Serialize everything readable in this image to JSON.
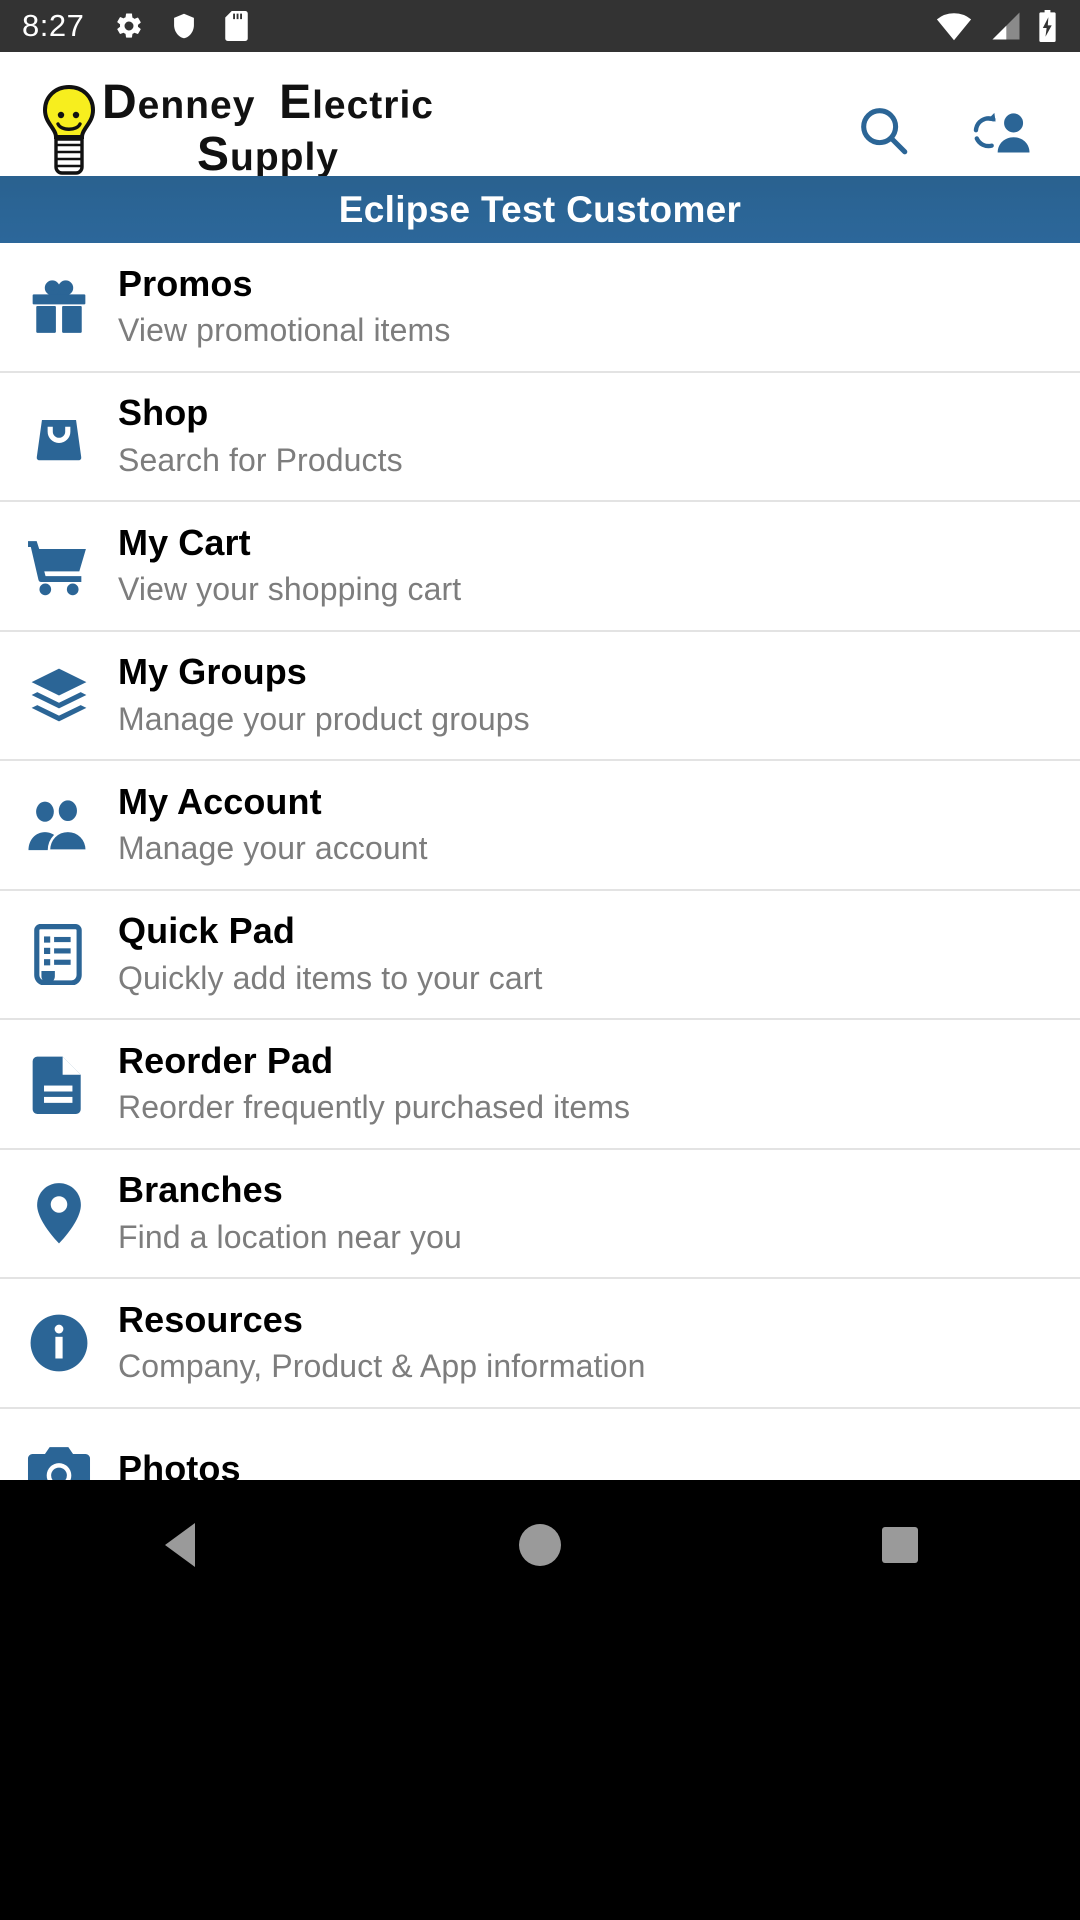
{
  "status_bar": {
    "time": "8:27",
    "left_icons": [
      "gear-icon",
      "shield-icon",
      "sd-card-icon"
    ],
    "right_icons": [
      "wifi-icon",
      "cell-signal-icon",
      "battery-charging-icon"
    ],
    "background": "#333333"
  },
  "header": {
    "logo": {
      "line1_part1": "D",
      "line1_rest": "enney",
      "line1_part2": "E",
      "line1_rest2": "lectric",
      "line2_part1": "S",
      "line2_rest": "upply",
      "full_text": "Denney Electric Supply",
      "bulb_color": "#f7ee1e"
    },
    "search_label": "search-icon",
    "switch_user_label": "switch-user-icon",
    "icon_color": "#2b6596"
  },
  "banner": {
    "customer_name": "Eclipse Test Customer",
    "background": "#2b6596",
    "text_color": "#ffffff"
  },
  "menu": {
    "items": [
      {
        "icon": "gift-icon",
        "title": "Promos",
        "subtitle": "View promotional items"
      },
      {
        "icon": "shopping-bag-icon",
        "title": "Shop",
        "subtitle": "Search for Products"
      },
      {
        "icon": "shopping-cart-icon",
        "title": "My Cart",
        "subtitle": "View your shopping cart"
      },
      {
        "icon": "layers-icon",
        "title": "My Groups",
        "subtitle": "Manage your product groups"
      },
      {
        "icon": "people-icon",
        "title": "My Account",
        "subtitle": "Manage your account"
      },
      {
        "icon": "receipt-list-icon",
        "title": "Quick Pad",
        "subtitle": "Quickly add items to your cart"
      },
      {
        "icon": "document-icon",
        "title": "Reorder Pad",
        "subtitle": "Reorder frequently purchased items"
      },
      {
        "icon": "map-pin-icon",
        "title": "Branches",
        "subtitle": "Find a location near you"
      },
      {
        "icon": "info-circle-icon",
        "title": "Resources",
        "subtitle": "Company, Product & App information"
      },
      {
        "icon": "camera-icon",
        "title": "Photos",
        "subtitle": ""
      }
    ],
    "icon_color": "#2b6596",
    "title_color": "#000000",
    "subtitle_color": "#7d7d7d"
  },
  "nav_bar": {
    "back_label": "back-button",
    "home_label": "home-button",
    "recents_label": "recents-button",
    "background": "#000000",
    "icon_color": "#9a9a9a"
  }
}
